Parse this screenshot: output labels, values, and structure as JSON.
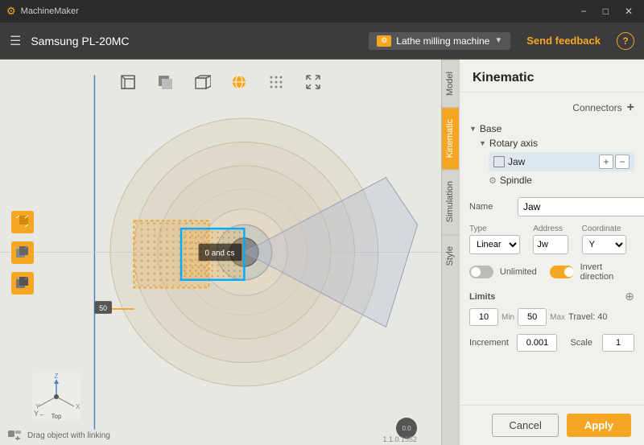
{
  "app": {
    "title": "MachineMaker",
    "machine_name": "Samsung PL-20MC",
    "machine_type": "Lathe milling machine",
    "feedback_label": "Send feedback",
    "help_label": "?"
  },
  "titlebar": {
    "minimize": "−",
    "maximize": "□",
    "close": "✕"
  },
  "toolbar": {
    "menu_icon": "☰"
  },
  "view_icons": [
    {
      "name": "box-outline-icon",
      "glyph": "⬜",
      "active": false
    },
    {
      "name": "box-solid-icon",
      "glyph": "⬛",
      "active": false
    },
    {
      "name": "box-wire-icon",
      "glyph": "⬜",
      "active": false
    },
    {
      "name": "sphere-icon",
      "glyph": "⊕",
      "active": true
    },
    {
      "name": "dot-icon",
      "glyph": "⊙",
      "active": false
    },
    {
      "name": "cross-icon",
      "glyph": "✕",
      "active": false
    }
  ],
  "side_tabs": [
    {
      "label": "Model",
      "active": false
    },
    {
      "label": "Kinematic",
      "active": true
    },
    {
      "label": "Simulation",
      "active": false
    },
    {
      "label": "Style",
      "active": false
    }
  ],
  "kinematic_panel": {
    "title": "Kinematic",
    "connectors_label": "Connectors",
    "add_icon": "+",
    "tree": {
      "base_label": "Base",
      "rotary_label": "Rotary axis",
      "jaw_label": "Jaw",
      "spindle_label": "Spindle"
    },
    "name_label": "Name",
    "name_value": "Jaw",
    "name_dots": "...",
    "type_label": "Type",
    "type_value": "Linear",
    "address_label": "Address",
    "address_value": "Jw",
    "coordinate_label": "Coordinate",
    "coordinate_value": "Y",
    "unlimited_label": "Unlimited",
    "invert_label": "Invert direction",
    "limits_label": "Limits",
    "limit_min": "10",
    "limit_min_label": "Min",
    "limit_max": "50",
    "limit_max_label": "Max",
    "travel_label": "Travel: 40",
    "increment_label": "Increment",
    "increment_value": "0.001",
    "scale_label": "Scale",
    "scale_value": "1",
    "cancel_label": "Cancel",
    "apply_label": "Apply"
  },
  "viewport": {
    "bottom_text": "Drag object with linking",
    "view_label": "Top",
    "axis_x": "X",
    "axis_y": "Y",
    "axis_z": "Z",
    "indicator": "0.0",
    "version": "1.1.0.1552"
  },
  "axis_label": {
    "label": "0"
  }
}
